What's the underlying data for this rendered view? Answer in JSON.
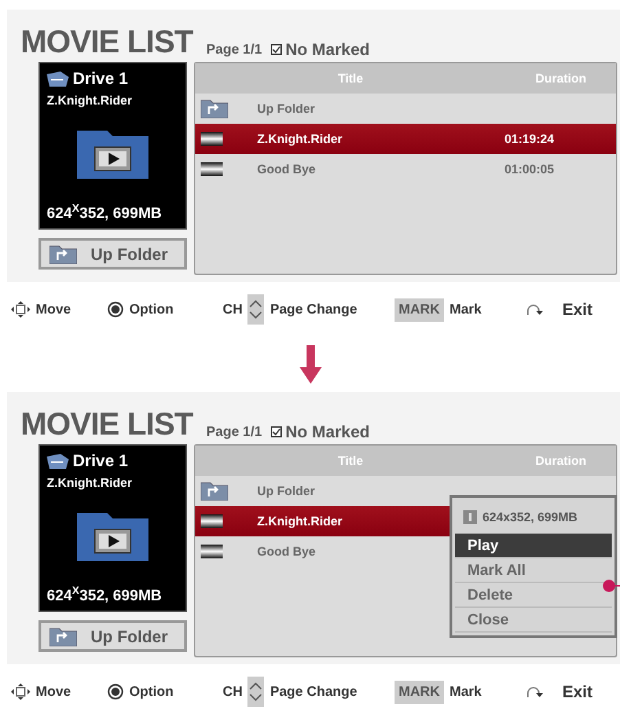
{
  "screens": [
    {
      "title": "MOVIE LIST",
      "page": "Page 1/1",
      "marked": "No Marked",
      "preview": {
        "drive": "Drive 1",
        "name": "Z.Knight.Rider",
        "info": "624$^{X}$352,  699MB"
      },
      "up_folder_button": "Up Folder",
      "columns": [
        "Title",
        "Duration"
      ],
      "rows": [
        {
          "kind": "folder",
          "title": "Up Folder",
          "selected": false
        },
        {
          "kind": "movie",
          "title": "Z.Knight.Rider",
          "duration": "01:19:24",
          "selected": true
        },
        {
          "kind": "movie",
          "title": "Good Bye",
          "duration": "01:00:05",
          "selected": false
        }
      ],
      "legend": [
        {
          "kind": "move",
          "label": "Move"
        },
        {
          "kind": "option",
          "label": "Option"
        },
        {
          "kind": "ch",
          "key": "CH",
          "label": "Page Change"
        },
        {
          "kind": "mark",
          "key": "MARK",
          "label": "Mark"
        },
        {
          "kind": "exit",
          "label": "Exit"
        }
      ]
    },
    {
      "title": "MOVIE LIST",
      "page": "Page 1/1",
      "marked": "No Marked",
      "preview": {
        "drive": "Drive 1",
        "name": "Z.Knight.Rider",
        "info": "624$^{X}$352,  699MB"
      },
      "up_folder_button": "Up Folder",
      "columns": [
        "Title",
        "Duration"
      ],
      "rows": [
        {
          "kind": "folder",
          "title": "Up Folder",
          "selected": false
        },
        {
          "kind": "movie",
          "title": "Z.Knight.Rider",
          "selected": true
        },
        {
          "kind": "movie",
          "title": "Good Bye",
          "selected": false
        }
      ],
      "option_menu": {
        "info": "624x352,  699MB",
        "items": [
          {
            "label": "Play",
            "selected": true
          },
          {
            "label": "Mark All",
            "selected": false
          },
          {
            "label": "Delete",
            "selected": false
          },
          {
            "label": "Close",
            "selected": false
          }
        ]
      },
      "legend": [
        {
          "kind": "move",
          "label": "Move"
        },
        {
          "kind": "option",
          "label": "Option"
        },
        {
          "kind": "ch",
          "key": "CH",
          "label": "Page Change"
        },
        {
          "kind": "mark",
          "key": "MARK",
          "label": "Mark"
        },
        {
          "kind": "exit",
          "label": "Exit"
        }
      ]
    }
  ]
}
